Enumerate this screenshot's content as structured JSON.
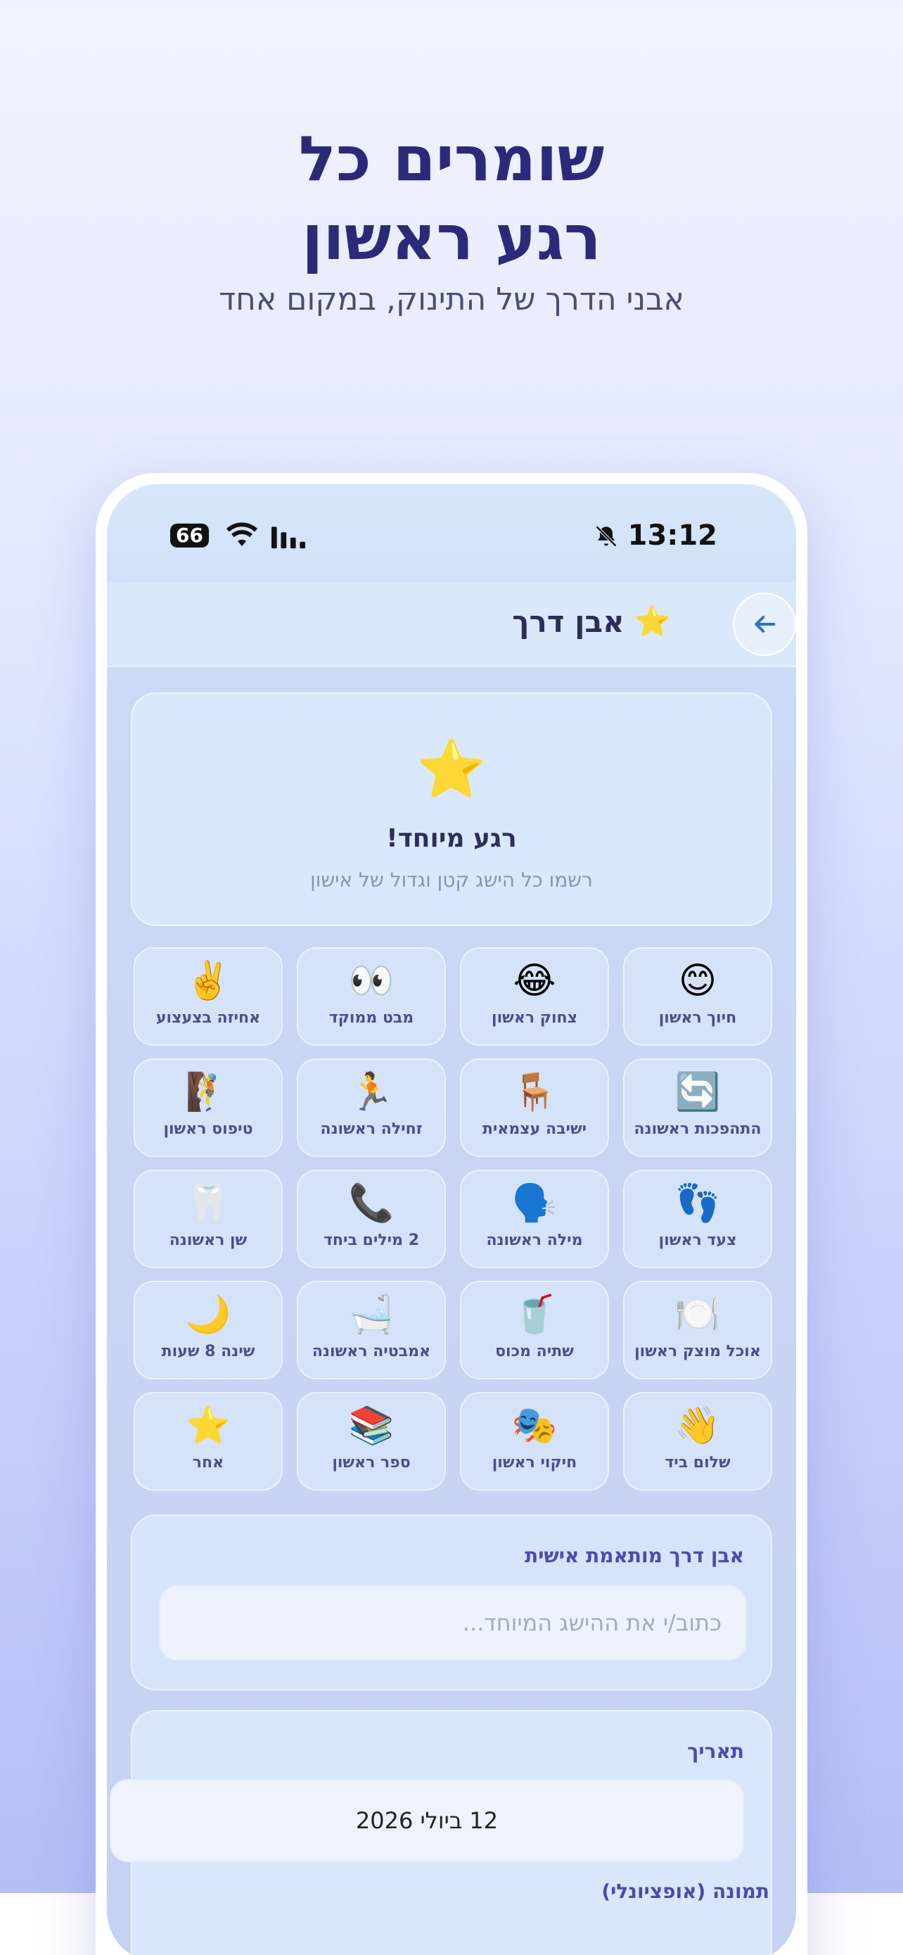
{
  "promo": {
    "headline_line1": "שומרים כל",
    "headline_line2": "רגע ראשון",
    "subheadline": "אבני הדרך של התינוק, במקום אחד"
  },
  "status_bar": {
    "time": "13:12",
    "battery": "66"
  },
  "app_bar": {
    "title": "אבן דרך",
    "title_emoji": "⭐",
    "back_icon": "arrow-left-icon"
  },
  "hero": {
    "emoji": "⭐",
    "title": "רגע מיוחד!",
    "subtitle": "רשמו כל הישג קטן וגדול של אישון"
  },
  "milestones": [
    {
      "emoji": "😊",
      "label": "חיוך ראשון"
    },
    {
      "emoji": "😂",
      "label": "צחוק ראשון"
    },
    {
      "emoji": "👀",
      "label": "מבט ממוקד"
    },
    {
      "emoji": "✌️",
      "label": "אחיזה בצעצוע"
    },
    {
      "emoji": "🔄",
      "label": "התהפכות ראשונה"
    },
    {
      "emoji": "🪑",
      "label": "ישיבה עצמאית"
    },
    {
      "emoji": "🏃",
      "label": "זחילה ראשונה"
    },
    {
      "emoji": "🧗",
      "label": "טיפוס ראשון"
    },
    {
      "emoji": "👣",
      "label": "צעד ראשון"
    },
    {
      "emoji": "🗣️",
      "label": "מילה ראשונה"
    },
    {
      "emoji": "📞",
      "label": "2 מילים ביחד"
    },
    {
      "emoji": "🦷",
      "label": "שן ראשונה"
    },
    {
      "emoji": "🍽️",
      "label": "אוכל מוצק ראשון"
    },
    {
      "emoji": "🥤",
      "label": "שתיה מכוס"
    },
    {
      "emoji": "🛁",
      "label": "אמבטיה ראשונה"
    },
    {
      "emoji": "🌙",
      "label": "שינה 8 שעות"
    },
    {
      "emoji": "👋",
      "label": "שלום ביד"
    },
    {
      "emoji": "🎭",
      "label": "חיקוי ראשון"
    },
    {
      "emoji": "📚",
      "label": "ספר ראשון"
    },
    {
      "emoji": "⭐",
      "label": "אחר"
    }
  ],
  "custom_milestone": {
    "label": "אבן דרך מותאמת אישית",
    "placeholder": "כתוב/י את ההישג המיוחד..."
  },
  "date_section": {
    "label": "תאריך",
    "value": "12 ביולי 2026",
    "next_label": "תמונה (אופציונלי)"
  },
  "colors": {
    "headline": "#2b2a7a",
    "accent": "#4c4ab0",
    "back_arrow": "#2f6fd6"
  }
}
